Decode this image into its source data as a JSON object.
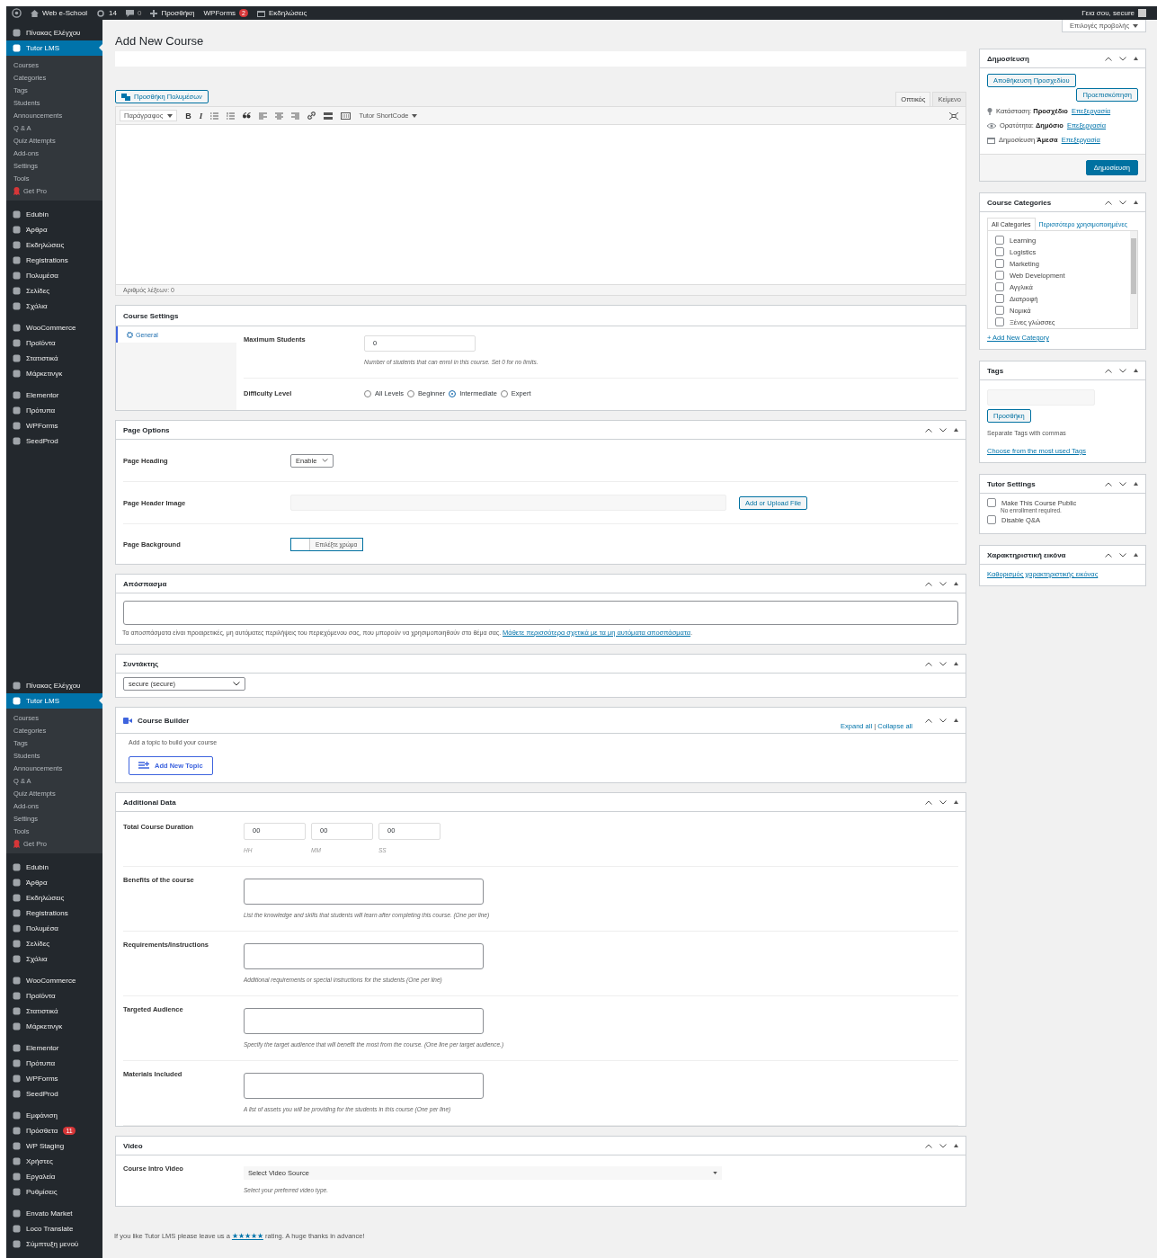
{
  "admin_bar": {
    "site": "Web e-School",
    "updates": "14",
    "comments": "0",
    "new": "Προσθήκη",
    "wpforms": "WPForms",
    "wpforms_badge": "2",
    "events": "Εκδηλώσεις",
    "greeting": "Γεια σου, secure"
  },
  "sidebar": {
    "menus": [
      {
        "groups": [
          {
            "items": [
              {
                "label": "Πίνακας Ελέγχου",
                "selected": false
              },
              {
                "label": "Tutor LMS",
                "selected": true,
                "submenu": [
                  {
                    "label": "Courses",
                    "kind": "plain"
                  },
                  {
                    "label": "Categories",
                    "kind": "plain"
                  },
                  {
                    "label": "Tags",
                    "kind": "plain"
                  },
                  {
                    "label": "Students",
                    "kind": "plain"
                  },
                  {
                    "label": "Announcements",
                    "kind": "plain"
                  },
                  {
                    "label": "Q & A",
                    "kind": "plain"
                  },
                  {
                    "label": "Quiz Attempts",
                    "kind": "plain"
                  },
                  {
                    "label": "Add-ons",
                    "kind": "plain"
                  },
                  {
                    "label": "Settings",
                    "kind": "plain"
                  },
                  {
                    "label": "Tools",
                    "kind": "plain"
                  },
                  {
                    "label": "Get Pro",
                    "kind": "promo"
                  }
                ]
              }
            ]
          },
          {
            "items": [
              {
                "label": "Edubin",
                "selected": false
              },
              {
                "label": "Άρθρα",
                "selected": false
              },
              {
                "label": "Εκδηλώσεις",
                "selected": false
              },
              {
                "label": "Registrations",
                "selected": false
              },
              {
                "label": "Πολυμέσα",
                "selected": false
              },
              {
                "label": "Σελίδες",
                "selected": false
              },
              {
                "label": "Σχόλια",
                "selected": false
              }
            ]
          },
          {
            "items": [
              {
                "label": "WooCommerce",
                "selected": false
              },
              {
                "label": "Προϊόντα",
                "selected": false
              },
              {
                "label": "Στατιστικά",
                "selected": false
              },
              {
                "label": "Μάρκετινγκ",
                "selected": false
              }
            ]
          },
          {
            "items": [
              {
                "label": "Elementor",
                "selected": false
              },
              {
                "label": "Πρότυπα",
                "selected": false
              },
              {
                "label": "WPForms",
                "selected": false
              },
              {
                "label": "SeedProd",
                "selected": false
              }
            ]
          }
        ]
      },
      {
        "groups": [
          {
            "items": [
              {
                "label": "Πίνακας Ελέγχου",
                "selected": false
              },
              {
                "label": "Tutor LMS",
                "selected": true,
                "submenu": [
                  {
                    "label": "Courses",
                    "kind": "plain"
                  },
                  {
                    "label": "Categories",
                    "kind": "plain"
                  },
                  {
                    "label": "Tags",
                    "kind": "plain"
                  },
                  {
                    "label": "Students",
                    "kind": "plain"
                  },
                  {
                    "label": "Announcements",
                    "kind": "plain"
                  },
                  {
                    "label": "Q & A",
                    "kind": "plain"
                  },
                  {
                    "label": "Quiz Attempts",
                    "kind": "plain"
                  },
                  {
                    "label": "Add-ons",
                    "kind": "plain"
                  },
                  {
                    "label": "Settings",
                    "kind": "plain"
                  },
                  {
                    "label": "Tools",
                    "kind": "plain"
                  },
                  {
                    "label": "Get Pro",
                    "kind": "promo"
                  }
                ]
              }
            ]
          },
          {
            "items": [
              {
                "label": "Edubin",
                "selected": false
              },
              {
                "label": "Άρθρα",
                "selected": false
              },
              {
                "label": "Εκδηλώσεις",
                "selected": false
              },
              {
                "label": "Registrations",
                "selected": false
              },
              {
                "label": "Πολυμέσα",
                "selected": false
              },
              {
                "label": "Σελίδες",
                "selected": false
              },
              {
                "label": "Σχόλια",
                "selected": false
              }
            ]
          },
          {
            "items": [
              {
                "label": "WooCommerce",
                "selected": false
              },
              {
                "label": "Προϊόντα",
                "selected": false
              },
              {
                "label": "Στατιστικά",
                "selected": false
              },
              {
                "label": "Μάρκετινγκ",
                "selected": false
              }
            ]
          },
          {
            "items": [
              {
                "label": "Elementor",
                "selected": false
              },
              {
                "label": "Πρότυπα",
                "selected": false
              },
              {
                "label": "WPForms",
                "selected": false
              },
              {
                "label": "SeedProd",
                "selected": false
              }
            ]
          },
          {
            "items": [
              {
                "label": "Εμφάνιση",
                "selected": false
              },
              {
                "label": "Πρόσθετα",
                "selected": false,
                "badge": "11"
              },
              {
                "label": "WP Staging",
                "selected": false
              },
              {
                "label": "Χρήστες",
                "selected": false
              },
              {
                "label": "Εργαλεία",
                "selected": false
              },
              {
                "label": "Ρυθμίσεις",
                "selected": false
              }
            ]
          },
          {
            "items": [
              {
                "label": "Envato Market",
                "selected": false
              },
              {
                "label": "Loco Translate",
                "selected": false
              },
              {
                "label": "Σύμπτυξη μενού",
                "selected": false
              }
            ]
          }
        ]
      }
    ]
  },
  "screen_options": "Επιλογές προβολής",
  "page_title": "Add New Course",
  "editor": {
    "add_media": "Προσθήκη Πολυμέσων",
    "tabs": [
      {
        "label": "Οπτικός",
        "selected": true
      },
      {
        "label": "Κείμενο",
        "selected": false
      }
    ],
    "toolbar": [
      {
        "kind": "select",
        "label": "Παράγραφος"
      },
      {
        "kind": "bold",
        "label": "B"
      },
      {
        "kind": "italic",
        "label": "I"
      },
      {
        "kind": "bullet-list"
      },
      {
        "kind": "numbered-list"
      },
      {
        "kind": "quote"
      },
      {
        "kind": "align-left"
      },
      {
        "kind": "align-center"
      },
      {
        "kind": "align-right"
      },
      {
        "kind": "link"
      },
      {
        "kind": "read-more"
      },
      {
        "kind": "toolbar-toggle"
      },
      {
        "kind": "dropdown",
        "label": "Tutor ShortCode"
      }
    ],
    "word_count": "Αριθμός λέξεων: 0"
  },
  "course_settings": {
    "title": "Course Settings",
    "tabs": [
      {
        "label": "General",
        "selected": true
      }
    ],
    "max_students": {
      "label": "Maximum Students",
      "value": "0",
      "hint": "Number of students that can enrol in this course. Set 0 for no limits."
    },
    "difficulty": {
      "label": "Difficulty Level",
      "options": [
        {
          "label": "All Levels",
          "selected": false
        },
        {
          "label": "Beginner",
          "selected": false
        },
        {
          "label": "Intermediate",
          "selected": true
        },
        {
          "label": "Expert",
          "selected": false
        }
      ]
    }
  },
  "page_options": {
    "title": "Page Options",
    "heading": {
      "label": "Page Heading",
      "value": "Enable"
    },
    "header_image": {
      "label": "Page Header Image",
      "button": "Add or Upload File"
    },
    "background": {
      "label": "Page Background",
      "button": "Επιλέξτε χρώμα"
    }
  },
  "excerpt": {
    "title": "Απόσπασμα",
    "help": "Τα αποσπάσματα είναι προαιρετικές, μη αυτόματες περιλήψεις του περιεχόμενου σας, που μπορούν να χρησιμοποιηθούν στο θέμα σας.",
    "link": "Μάθετε περισσότερα σχετικά με τα μη αυτόματα αποσπάσματα",
    "after": "."
  },
  "author": {
    "title": "Συντάκτης",
    "value": "secure (secure)"
  },
  "course_builder": {
    "title": "Course Builder",
    "expand": "Expand all",
    "separator": "|",
    "collapse": "Collapse all",
    "hint": "Add a topic to build your course",
    "button": "Add New Topic"
  },
  "additional_data": {
    "title": "Additional Data",
    "duration": {
      "label": "Total Course Duration",
      "fields": [
        {
          "value": "00",
          "unit": "HH"
        },
        {
          "value": "00",
          "unit": "MM"
        },
        {
          "value": "00",
          "unit": "SS"
        }
      ]
    },
    "textareas": [
      {
        "label": "Benefits of the course",
        "hint": "List the knowledge and skills that students will learn after completing this course. (One per line)"
      },
      {
        "label": "Requirements/Instructions",
        "hint": "Additional requirements or special instructions for the students (One per line)"
      },
      {
        "label": "Targeted Audience",
        "hint": "Specify the target audience that will benefit the most from the course. (One line per target audience.)"
      },
      {
        "label": "Materials Included",
        "hint": "A list of assets you will be providing for the students in this course (One per line)"
      }
    ]
  },
  "video": {
    "title": "Video",
    "label": "Course Intro Video",
    "value": "Select Video Source",
    "hint": "Select your preferred video type."
  },
  "footer": {
    "before": "If you like Tutor LMS please leave us a",
    "link": "★★★★★",
    "after": "rating. A huge thanks in advance!"
  },
  "publish": {
    "title": "Δημοσίευση",
    "save_draft": "Αποθήκευση Προσχεδίου",
    "preview": "Προεπισκόπηση",
    "rows": [
      {
        "kind": "status",
        "label": "Κατάσταση:",
        "value": "Προσχέδιο",
        "link": "Επεξεργασία"
      },
      {
        "kind": "visibility",
        "label": "Ορατότητα:",
        "value": "Δημόσιο",
        "link": "Επεξεργασία"
      },
      {
        "kind": "schedule",
        "label": "Δημοσίευση",
        "value": "Άμεσα",
        "link": "Επεξεργασία"
      }
    ],
    "publish_button": "Δημοσίευση"
  },
  "categories": {
    "title": "Course Categories",
    "tabs": [
      {
        "label": "All Categories",
        "selected": true
      },
      {
        "label": "Περισσότερο χρησιμοποιημένες",
        "selected": false
      }
    ],
    "items": [
      {
        "label": "Learning",
        "checked": false
      },
      {
        "label": "Logistics",
        "checked": false
      },
      {
        "label": "Marketing",
        "checked": false
      },
      {
        "label": "Web Development",
        "checked": false
      },
      {
        "label": "Αγγλικά",
        "checked": false
      },
      {
        "label": "Διατροφή",
        "checked": false
      },
      {
        "label": "Νομικά",
        "checked": false
      },
      {
        "label": "Ξένες γλώσσες",
        "checked": false
      }
    ],
    "add_link": "+ Add New Category"
  },
  "tags": {
    "title": "Tags",
    "button": "Προσθήκη",
    "hint": "Separate Tags with commas",
    "link": "Choose from the most used Tags"
  },
  "tutor_settings": {
    "title": "Tutor Settings",
    "options": [
      {
        "label": "Make This Course Public",
        "note": "No enrollment required.",
        "checked": false
      },
      {
        "label": "Disable Q&A",
        "checked": false
      }
    ]
  },
  "featured_image": {
    "title": "Χαρακτηριστική εικόνα",
    "link": "Καθορισμός χαρακτηριστικής εικόνας"
  }
}
